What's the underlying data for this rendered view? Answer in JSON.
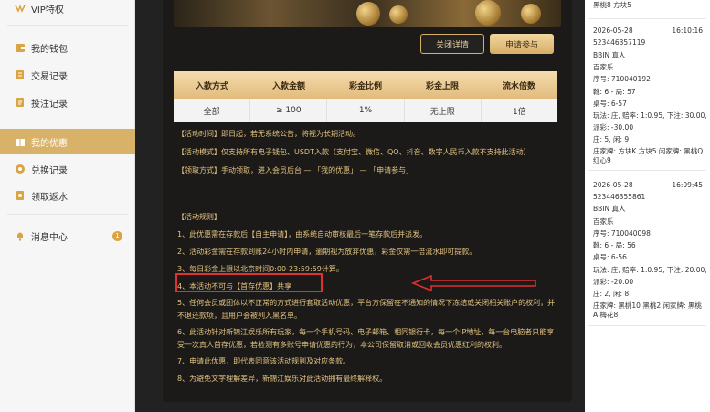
{
  "sidebar": {
    "items": [
      {
        "label": "VIP特权",
        "icon": "vip-icon"
      },
      {
        "label": "我的钱包",
        "icon": "wallet-icon"
      },
      {
        "label": "交易记录",
        "icon": "transaction-icon"
      },
      {
        "label": "投注记录",
        "icon": "bet-record-icon"
      },
      {
        "label": "我的优惠",
        "icon": "gift-icon"
      },
      {
        "label": "兑换记录",
        "icon": "exchange-icon"
      },
      {
        "label": "领取返水",
        "icon": "rebate-icon"
      },
      {
        "label": "消息中心",
        "icon": "bell-icon"
      }
    ],
    "badge_count": "1"
  },
  "actions": {
    "rules_label": "关闭详情",
    "apply_label": "申请参与"
  },
  "promo_table": {
    "headers": [
      "入款方式",
      "入款金额",
      "彩金比例",
      "彩金上限",
      "流水倍数"
    ],
    "row": [
      "全部",
      "≥ 100",
      "1%",
      "无上限",
      "1倍"
    ]
  },
  "promo_text": {
    "time": "【活动时间】即日起，若无系统公告，将视为长期活动。",
    "mode": "【活动模式】仅支持所有电子钱包、USDT入款（支付宝、微信、QQ、抖音、数字人民币入款不支持此活动）",
    "claim": "【领取方式】手动领取，进入会员后台 — 「我的优惠」 — 「申请参与」",
    "rules_title": "【活动规则】",
    "rule1": "1、此优惠需在存款后【自主申请】，由系统自动审核最后一笔存款后并派发。",
    "rule2": "2、活动彩金需在存款到账24小时内申请，逾期视为放弃优惠，彩金仅需一倍流水即可提款。",
    "rule3": "3、每日彩金上限以北京时间0:00-23:59:59计算。",
    "rule4": "4、本活动不可与【首存优惠】共享",
    "rule5": "5、任何会员或团体以不正常的方式进行套取活动优惠，平台方保留在不通知的情况下冻结或关闭相关账户的权利，并不退还款项，且用户会被列入黑名单。",
    "rule6": "6、此活动针对新锦江娱乐所有玩家，每一个手机号码、电子邮箱、相同银行卡，每一个IP地址，每一台电脑者只能享受一次真人首存优惠，若检测有多账号申请优惠的行为，本公司保留取消或回收会员优惠红利的权利。",
    "rule7": "7、申请此优惠，即代表同意该活动规则及对应条款。",
    "rule8": "8、为避免文字理解差异，新锦江娱乐对此活动拥有最终解释权。"
  },
  "bet_records": [
    {
      "top_line": "黑桃8 方块5"
    },
    {
      "date": "2026-05-28",
      "time": "16:10:16",
      "id": "523446357119",
      "platform": "BBIN 真人",
      "game": "百家乐",
      "serial": "序号: 710040192",
      "round": "靴: 6 - 局: 57",
      "table": "桌号: 6-57",
      "play": "玩法: 庄, 赔率: 1:0.95, 下注: 30.00,",
      "payout": "派彩: -30.00",
      "result": "庄: 5, 闲: 9",
      "cards": "庄家牌: 方块K 方块5 闲家牌: 黑桃Q 红心9"
    },
    {
      "date": "2026-05-28",
      "time": "16:09:45",
      "id": "523446355861",
      "platform": "BBIN 真人",
      "game": "百家乐",
      "serial": "序号: 710040098",
      "round": "靴: 6 - 局: 56",
      "table": "桌号: 6-56",
      "play": "玩法: 庄, 赔率: 1:0.95, 下注: 20.00,",
      "payout": "派彩: -20.00",
      "result": "庄: 2, 闲: 8",
      "cards": "庄家牌: 黑桃10 黑桃2 闲家牌: 黑桃A 梅花8"
    }
  ],
  "colors": {
    "accent_gold": "#d9b26a",
    "highlight_red": "#e03030"
  }
}
